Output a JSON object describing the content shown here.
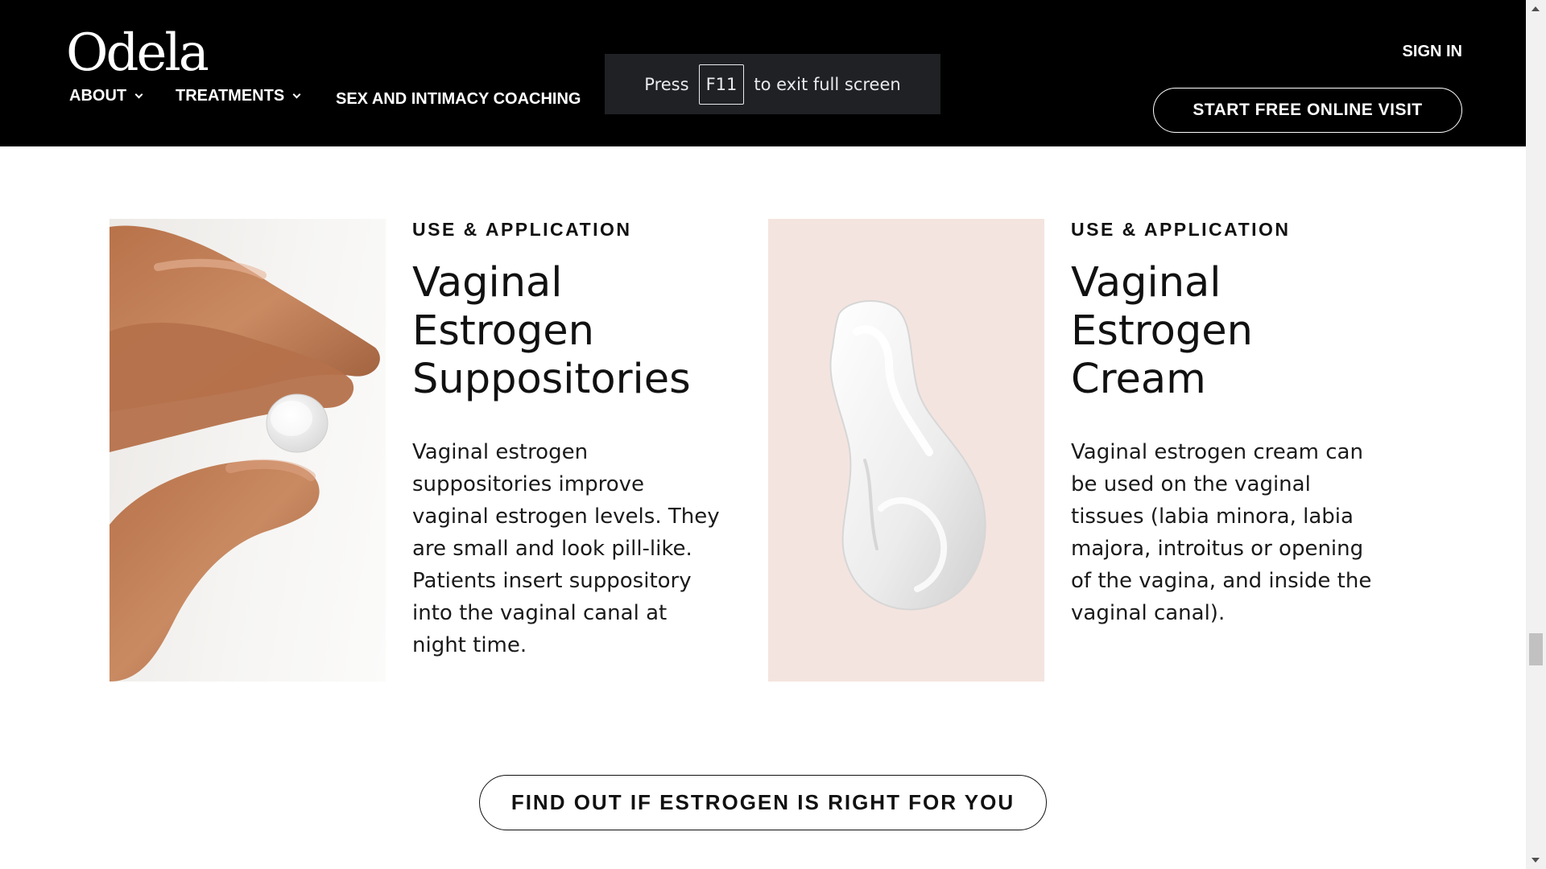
{
  "header": {
    "logo_text": "Odela",
    "nav": [
      {
        "label": "ABOUT"
      },
      {
        "label": "TREATMENTS"
      },
      {
        "label": "SEX AND INTIMACY COACHING"
      }
    ],
    "sign_in_label": "SIGN IN",
    "cta_label": "START FREE ONLINE VISIT"
  },
  "fullscreen_toast": {
    "press": "Press",
    "key": "F11",
    "message": "to exit full screen"
  },
  "products": [
    {
      "eyebrow": "USE & APPLICATION",
      "title": "Vaginal Estrogen Suppositories",
      "description": "Vaginal estrogen suppositories improve vaginal estrogen levels. They are small and look pill-like. Patients insert suppository into the vaginal canal at night time."
    },
    {
      "eyebrow": "USE & APPLICATION",
      "title": "Vaginal Estrogen Cream",
      "description": "Vaginal estrogen cream can be used on the vaginal tissues (labia minora, labia majora, introitus or opening of the vagina, and inside the vaginal canal)."
    }
  ],
  "main_cta_label": "FIND OUT IF ESTROGEN IS RIGHT FOR YOU",
  "colors": {
    "header_bg": "#000000",
    "cream_card_bg": "#f4e4df",
    "text": "#111111"
  },
  "icons": {
    "nav_dropdown": "chevron-down-icon"
  }
}
